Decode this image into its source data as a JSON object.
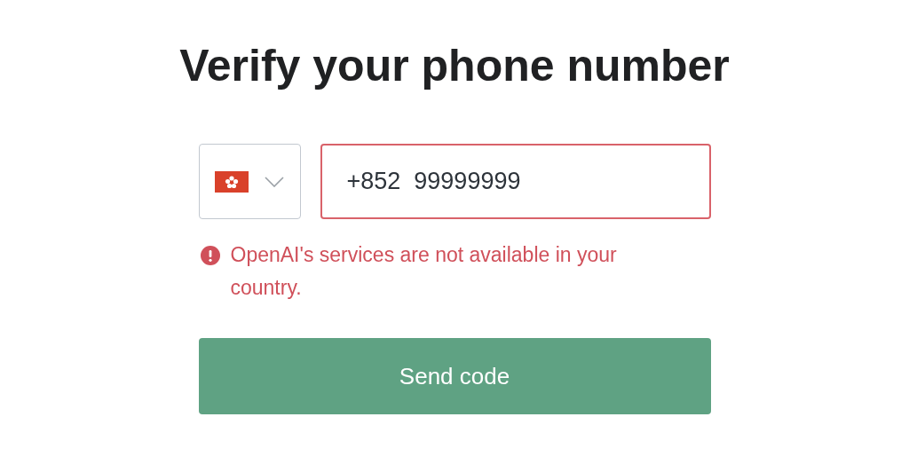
{
  "title": "Verify your phone number",
  "phone_field": {
    "value": "+852  99999999",
    "invalid": true
  },
  "error": "OpenAI's services are not available in your country.",
  "button": "Send code"
}
